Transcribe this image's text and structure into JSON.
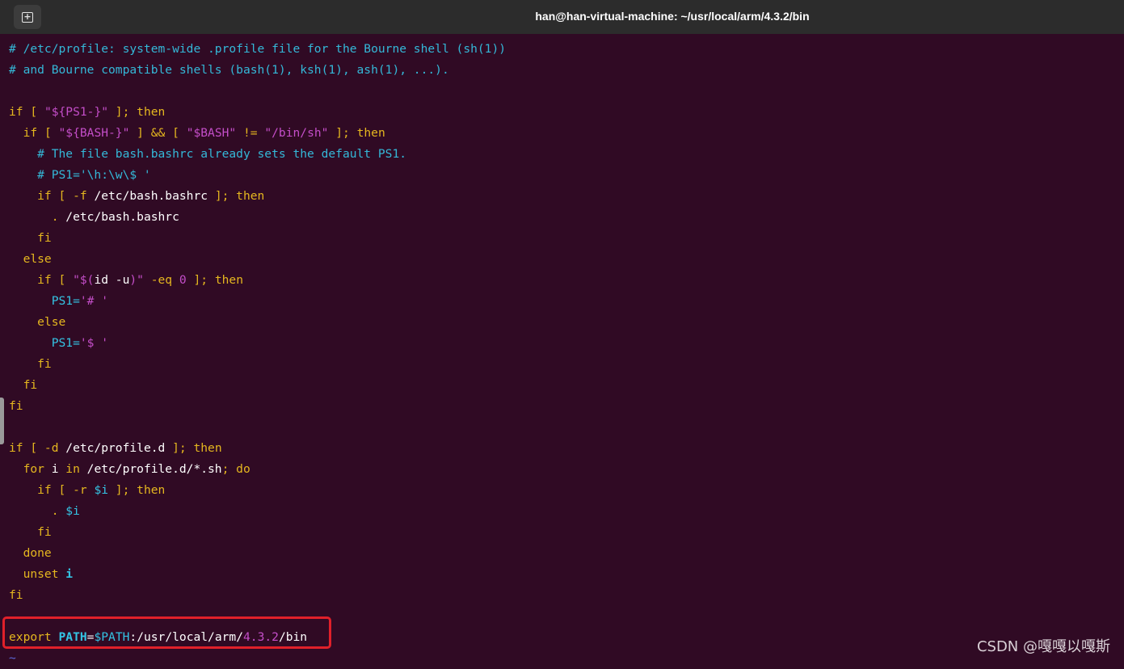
{
  "window": {
    "title": "han@han-virtual-machine: ~/usr/local/arm/4.3.2/bin",
    "new_tab_icon": "new-tab-icon",
    "new_tab_glyph": "+"
  },
  "file_lines": [
    [
      {
        "t": "# /etc/profile: system-wide .profile file for the Bourne shell (sh(1))",
        "c": "c"
      }
    ],
    [
      {
        "t": "# and Bourne compatible shells (bash(1), ksh(1), ash(1), ...).",
        "c": "c"
      }
    ],
    [],
    [
      {
        "t": "if",
        "c": "k"
      },
      {
        "t": " [ ",
        "c": "k"
      },
      {
        "t": "\"${PS1-}\"",
        "c": "s"
      },
      {
        "t": " ]; then",
        "c": "k"
      }
    ],
    [
      {
        "t": "  if",
        "c": "k"
      },
      {
        "t": " [ ",
        "c": "k"
      },
      {
        "t": "\"${BASH-}\"",
        "c": "s"
      },
      {
        "t": " ] && [ ",
        "c": "k"
      },
      {
        "t": "\"$BASH\"",
        "c": "s"
      },
      {
        "t": " != ",
        "c": "k"
      },
      {
        "t": "\"/bin/sh\"",
        "c": "s"
      },
      {
        "t": " ]; then",
        "c": "k"
      }
    ],
    [
      {
        "t": "    # The file bash.bashrc already sets the default PS1.",
        "c": "c"
      }
    ],
    [
      {
        "t": "    # PS1='\\h:\\w\\$ '",
        "c": "c"
      }
    ],
    [
      {
        "t": "    if",
        "c": "k"
      },
      {
        "t": " [ -f ",
        "c": "k"
      },
      {
        "t": "/etc/bash.bashrc",
        "c": "w"
      },
      {
        "t": " ]; then",
        "c": "k"
      }
    ],
    [
      {
        "t": "      . ",
        "c": "k"
      },
      {
        "t": "/etc/bash.bashrc",
        "c": "w"
      }
    ],
    [
      {
        "t": "    fi",
        "c": "k"
      }
    ],
    [
      {
        "t": "  else",
        "c": "k"
      }
    ],
    [
      {
        "t": "    if",
        "c": "k"
      },
      {
        "t": " [ ",
        "c": "k"
      },
      {
        "t": "\"$(",
        "c": "s"
      },
      {
        "t": "id -u",
        "c": "w"
      },
      {
        "t": ")\"",
        "c": "s"
      },
      {
        "t": " -eq ",
        "c": "k"
      },
      {
        "t": "0",
        "c": "s"
      },
      {
        "t": " ]; then",
        "c": "k"
      }
    ],
    [
      {
        "t": "      PS1=",
        "c": "v"
      },
      {
        "t": "'# '",
        "c": "s"
      }
    ],
    [
      {
        "t": "    else",
        "c": "k"
      }
    ],
    [
      {
        "t": "      PS1=",
        "c": "v"
      },
      {
        "t": "'$ '",
        "c": "s"
      }
    ],
    [
      {
        "t": "    fi",
        "c": "k"
      }
    ],
    [
      {
        "t": "  fi",
        "c": "k"
      }
    ],
    [
      {
        "t": "fi",
        "c": "k"
      }
    ],
    [],
    [
      {
        "t": "if",
        "c": "k"
      },
      {
        "t": " [ -d ",
        "c": "k"
      },
      {
        "t": "/etc/profile.d",
        "c": "w"
      },
      {
        "t": " ]; then",
        "c": "k"
      }
    ],
    [
      {
        "t": "  for",
        "c": "k"
      },
      {
        "t": " i ",
        "c": "w"
      },
      {
        "t": "in",
        "c": "k"
      },
      {
        "t": " /etc/profile.d/*.sh",
        "c": "w"
      },
      {
        "t": "; do",
        "c": "k"
      }
    ],
    [
      {
        "t": "    if",
        "c": "k"
      },
      {
        "t": " [ -r ",
        "c": "k"
      },
      {
        "t": "$i",
        "c": "v"
      },
      {
        "t": " ]; then",
        "c": "k"
      }
    ],
    [
      {
        "t": "      . ",
        "c": "k"
      },
      {
        "t": "$i",
        "c": "v"
      }
    ],
    [
      {
        "t": "    fi",
        "c": "k"
      }
    ],
    [
      {
        "t": "  done",
        "c": "k"
      }
    ],
    [
      {
        "t": "  unset ",
        "c": "k"
      },
      {
        "t": "i",
        "c": "vb"
      }
    ],
    [
      {
        "t": "fi",
        "c": "k"
      }
    ],
    [],
    [
      {
        "t": "export ",
        "c": "k"
      },
      {
        "t": "PATH",
        "c": "vb"
      },
      {
        "t": "=",
        "c": "w"
      },
      {
        "t": "$PATH",
        "c": "v"
      },
      {
        "t": ":/usr/local/arm/",
        "c": "w"
      },
      {
        "t": "4.3.2",
        "c": "s"
      },
      {
        "t": "/bin",
        "c": "w"
      }
    ],
    [
      {
        "t": "~",
        "c": "tilde"
      }
    ]
  ],
  "watermark": "CSDN @嘎嘎以嘎斯",
  "colors": {
    "background": "#300a24",
    "titlebar": "#2c2c2c",
    "comment": "#34b8d8",
    "keyword": "#e5b71f",
    "string": "#c44ec9",
    "variable": "#34c4e4",
    "highlight_box": "#e0202a"
  }
}
